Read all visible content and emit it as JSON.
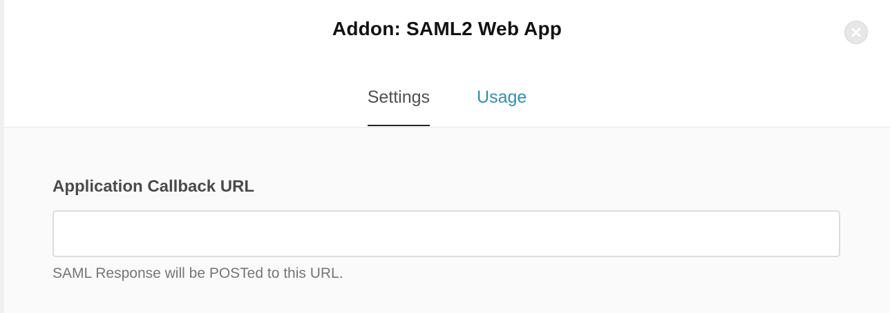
{
  "modal": {
    "title": "Addon: SAML2 Web App",
    "close_icon": "close-icon"
  },
  "tabs": [
    {
      "label": "Settings",
      "active": true
    },
    {
      "label": "Usage",
      "active": false
    }
  ],
  "form": {
    "callback_url": {
      "label": "Application Callback URL",
      "value": "",
      "placeholder": "",
      "help": "SAML Response will be POSTed to this URL."
    }
  },
  "colors": {
    "tab_link": "#2e8fb0",
    "tab_active": "#4f4f4f",
    "title": "#111111"
  }
}
